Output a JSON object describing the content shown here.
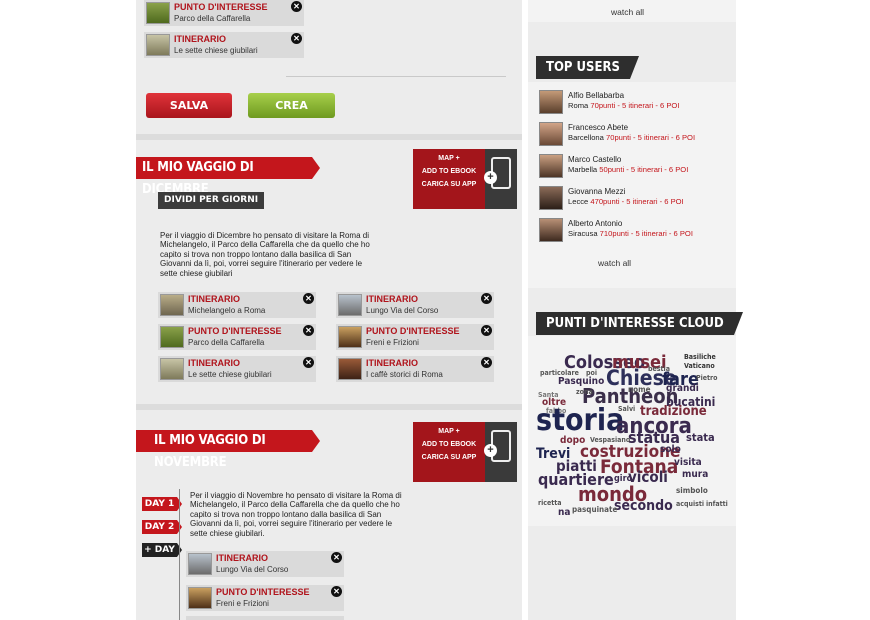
{
  "top_items": [
    {
      "type": "PUNTO D'INTERESSE",
      "name": "Parco della Caffarella",
      "thumb": "#6f8a2e"
    },
    {
      "type": "ITINERARIO",
      "name": "Le sette chiese giubilari",
      "thumb": "#a7a17c"
    }
  ],
  "buttons": {
    "save": "SALVA",
    "create": "CREA"
  },
  "trip_dec": {
    "title": "IL MIO VAGGIO DI DICEMBRE",
    "app_lines": [
      "MAP +",
      "ADD TO EBOOK",
      "CARICA SU APP"
    ],
    "split_label": "DIVIDI PER GIORNI",
    "description": "Per il viaggio di Dicembre ho pensato di visitare la Roma di Michelangelo, il Parco della Caffarella che da quello che ho capito si trova non troppo lontano dalla basilica di San Giovanni da lì, poi, vorrei seguire l'itinerario per vedere le sette chiese giubilari",
    "left_items": [
      {
        "type": "ITINERARIO",
        "name": "Michelangelo a Roma",
        "thumb": "#8e8770"
      },
      {
        "type": "PUNTO D'INTERESSE",
        "name": "Parco della Caffarella",
        "thumb": "#6f8a2e"
      },
      {
        "type": "ITINERARIO",
        "name": "Le sette chiese giubilari",
        "thumb": "#a7a17c"
      }
    ],
    "right_items": [
      {
        "type": "ITINERARIO",
        "name": "Lungo Via del Corso",
        "thumb": "#8b8b8b"
      },
      {
        "type": "PUNTO D'INTERESSE",
        "name": "Freni e Frizioni",
        "thumb": "#6d4a2c"
      },
      {
        "type": "ITINERARIO",
        "name": "I caffè storici di Roma",
        "thumb": "#6b3d2a"
      }
    ]
  },
  "trip_nov": {
    "title": "IL MIO VAGGIO DI NOVEMBRE",
    "app_lines": [
      "MAP +",
      "ADD TO EBOOK",
      "CARICA SU APP"
    ],
    "days": [
      "DAY 1",
      "DAY 2",
      "+ DAY"
    ],
    "description": "Per il viaggio di Novembre ho pensato di visitare la Roma di Michelangelo, il Parco della Caffarella che da quello che ho capito si trova non troppo lontano dalla basilica di San Giovanni da lì, poi, vorrei seguire l'itinerario per vedere le sette chiese giubilari.",
    "items": [
      {
        "type": "ITINERARIO",
        "name": "Lungo Via del Corso",
        "thumb": "#8b8b8b"
      },
      {
        "type": "PUNTO D'INTERESSE",
        "name": "Freni e Frizioni",
        "thumb": "#6d4a2c"
      }
    ]
  },
  "sidebar": {
    "watch_all_top": "watch all",
    "top_users_title": "TOP USERS",
    "users": [
      {
        "name": "Alfio Bellabarba",
        "city": "Roma",
        "stats": "70punti - 5 itinerari - 6 POI"
      },
      {
        "name": "Francesco Abete",
        "city": "Barcellona",
        "stats": "70punti - 5 itinerari - 6 POI"
      },
      {
        "name": "Marco Castello",
        "city": "Marbella",
        "stats": "50punti - 5 itinerari - 6 POI"
      },
      {
        "name": "Giovanna Mezzi",
        "city": "Lecce",
        "stats": "470punti - 5 itinerari - 6 POI"
      },
      {
        "name": "Alberto Antonio",
        "city": "Siracusa",
        "stats": "710punti - 5 itinerari - 6 POI"
      }
    ],
    "watch_all": "watch all",
    "cloud_title": "PUNTI D'INTERESSE CLOUD",
    "cloud_words": [
      {
        "w": "Colosseo",
        "c": "#3a2a4f"
      },
      {
        "w": "musei",
        "c": "#7a2a3a"
      },
      {
        "w": "Basiliche",
        "c": "#333"
      },
      {
        "w": "Vaticano",
        "c": "#333"
      },
      {
        "w": "particolare",
        "c": "#555"
      },
      {
        "w": "poi",
        "c": "#555"
      },
      {
        "w": "Chiese",
        "c": "#2d2f5a"
      },
      {
        "w": "bestia",
        "c": "#555"
      },
      {
        "w": "fare",
        "c": "#1e2450"
      },
      {
        "w": "Pasquino",
        "c": "#3a2a4f"
      },
      {
        "w": "Pietro",
        "c": "#555"
      },
      {
        "w": "grandi",
        "c": "#3a2a4f"
      },
      {
        "w": "Pantheon",
        "c": "#3b2f4a"
      },
      {
        "w": "zona",
        "c": "#555"
      },
      {
        "w": "nome",
        "c": "#555"
      },
      {
        "w": "bucatini",
        "c": "#3a2a4f"
      },
      {
        "w": "Santa",
        "c": "#777"
      },
      {
        "w": "oltre",
        "c": "#7a2a3a"
      },
      {
        "w": "Salvi",
        "c": "#555"
      },
      {
        "w": "tradizione",
        "c": "#7a2a3a"
      },
      {
        "w": "fabbo",
        "c": "#777"
      },
      {
        "w": "storia",
        "c": "#1e2450"
      },
      {
        "w": "ancora",
        "c": "#3a2a4f"
      },
      {
        "w": "statua",
        "c": "#3a2a4f"
      },
      {
        "w": "dopo",
        "c": "#7a2a3a"
      },
      {
        "w": "Vespasiano",
        "c": "#555"
      },
      {
        "w": "stata",
        "c": "#3a2a4f"
      },
      {
        "w": "Trevi",
        "c": "#1e2450"
      },
      {
        "w": "costruzione",
        "c": "#7a2a3a"
      },
      {
        "w": "solo",
        "c": "#3a2a4f"
      },
      {
        "w": "piatti",
        "c": "#3a2a4f"
      },
      {
        "w": "Fontana",
        "c": "#7a2a3a"
      },
      {
        "w": "visita",
        "c": "#3a2a4f"
      },
      {
        "w": "quartiere",
        "c": "#3a2a4f"
      },
      {
        "w": "vicoli",
        "c": "#3a2a4f"
      },
      {
        "w": "giro",
        "c": "#3a2a4f"
      },
      {
        "w": "mondo",
        "c": "#7a2a3a"
      },
      {
        "w": "mura",
        "c": "#3a2a4f"
      },
      {
        "w": "secondo",
        "c": "#3a2a4f"
      },
      {
        "w": "simbolo",
        "c": "#555"
      },
      {
        "w": "na",
        "c": "#3a2a4f"
      },
      {
        "w": "pasquinate",
        "c": "#555"
      },
      {
        "w": "acquisti",
        "c": "#555"
      },
      {
        "w": "infatti",
        "c": "#555"
      },
      {
        "w": "ricetta",
        "c": "#555"
      }
    ]
  }
}
